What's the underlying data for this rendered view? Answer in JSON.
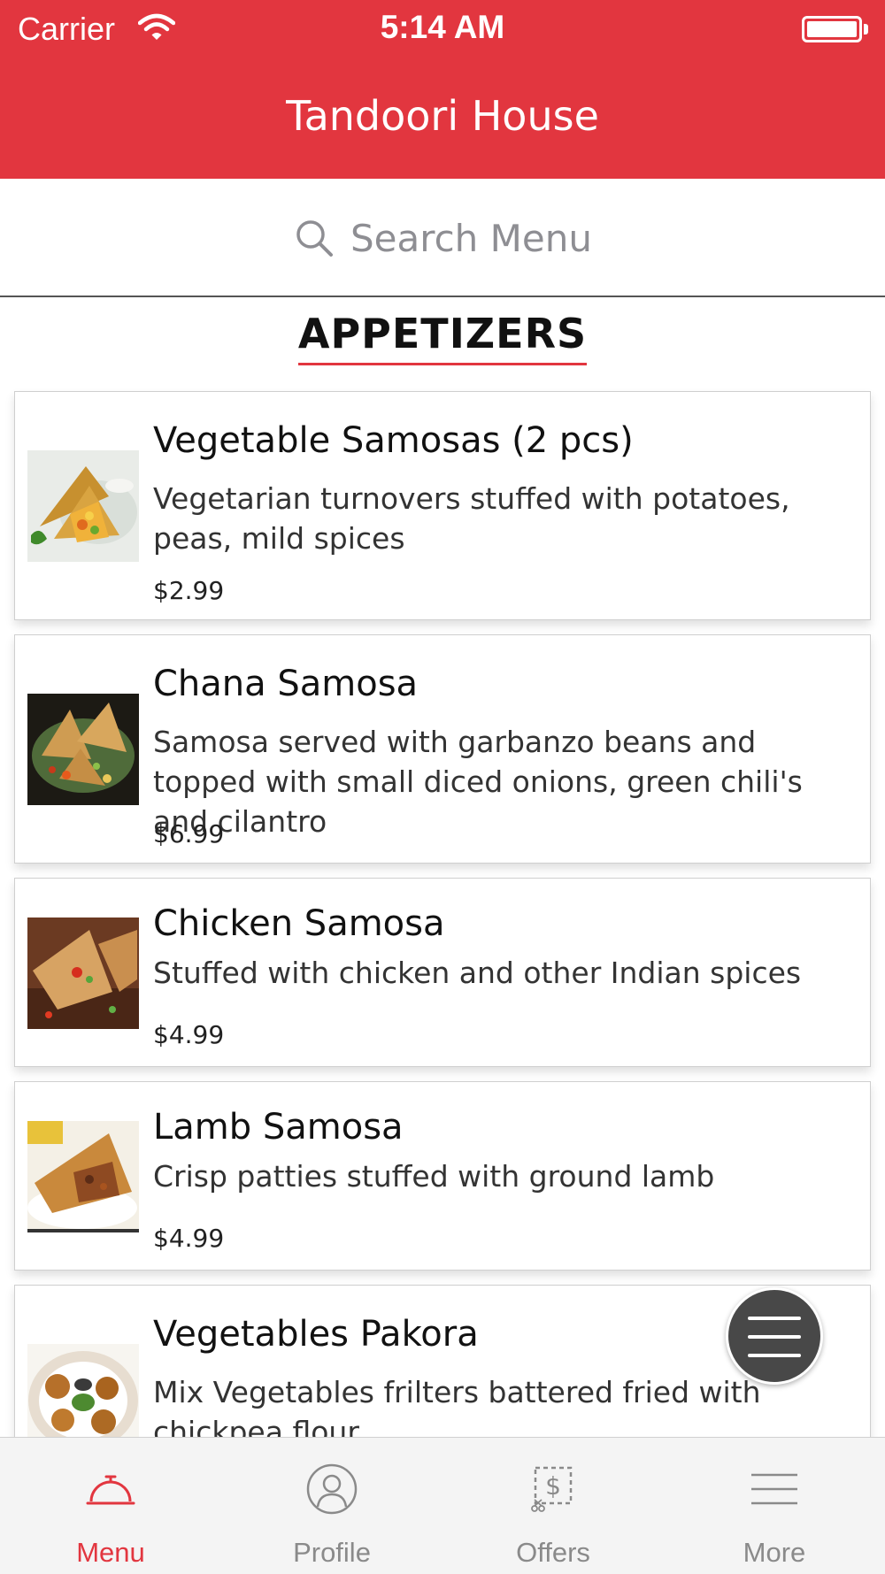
{
  "status_bar": {
    "carrier": "Carrier",
    "time": "5:14 AM"
  },
  "header": {
    "title": "Tandoori House"
  },
  "search": {
    "placeholder": "Search Menu"
  },
  "category": {
    "title": "APPETIZERS"
  },
  "items": [
    {
      "name": "Vegetable Samosas (2 pcs)",
      "description": "Vegetarian turnovers stuffed with potatoes, peas, mild spices",
      "price": "$2.99"
    },
    {
      "name": "Chana Samosa",
      "description": "Samosa served with garbanzo beans and topped with small diced onions, green chili's and cilantro",
      "price": "$6.99"
    },
    {
      "name": "Chicken Samosa",
      "description": "Stuffed with chicken and other Indian spices",
      "price": "$4.99"
    },
    {
      "name": "Lamb Samosa",
      "description": "Crisp patties stuffed with ground lamb",
      "price": "$4.99"
    },
    {
      "name": "Vegetables Pakora",
      "description": "Mix Vegetables frilters battered fried with chickpea flour",
      "price": ""
    }
  ],
  "tabs": [
    {
      "label": "Menu",
      "icon": "cloche-icon",
      "active": true
    },
    {
      "label": "Profile",
      "icon": "profile-icon",
      "active": false
    },
    {
      "label": "Offers",
      "icon": "coupon-icon",
      "active": false
    },
    {
      "label": "More",
      "icon": "more-lines-icon",
      "active": false
    }
  ],
  "colors": {
    "brand": "#e2363f",
    "tab_inactive": "#8a8a8a",
    "fab": "#484848"
  }
}
